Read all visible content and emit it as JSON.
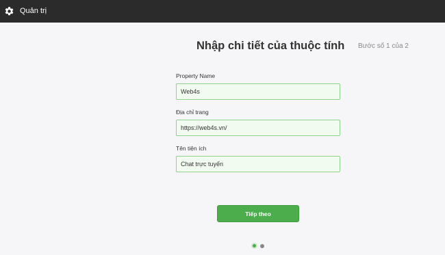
{
  "header": {
    "title": "Quản trị",
    "icon": "gear-icon"
  },
  "main": {
    "heading": "Nhập chi tiết của thuộc tính",
    "step_text": "Bước số 1 của 2",
    "fields": [
      {
        "label": "Property Name",
        "value": "Web4s"
      },
      {
        "label": "Địa chỉ trang",
        "value": "https://web4s.vn/"
      },
      {
        "label": "Tên tiện ích",
        "value": "Chat trực tuyến"
      }
    ],
    "next_label": "Tiếp theo",
    "pagination": {
      "current": 1,
      "total": 2
    }
  },
  "colors": {
    "accent": "#4cad4c",
    "topbar": "#2b2b2b",
    "field_bg": "#f1fbef",
    "field_border": "#8fd18f"
  }
}
